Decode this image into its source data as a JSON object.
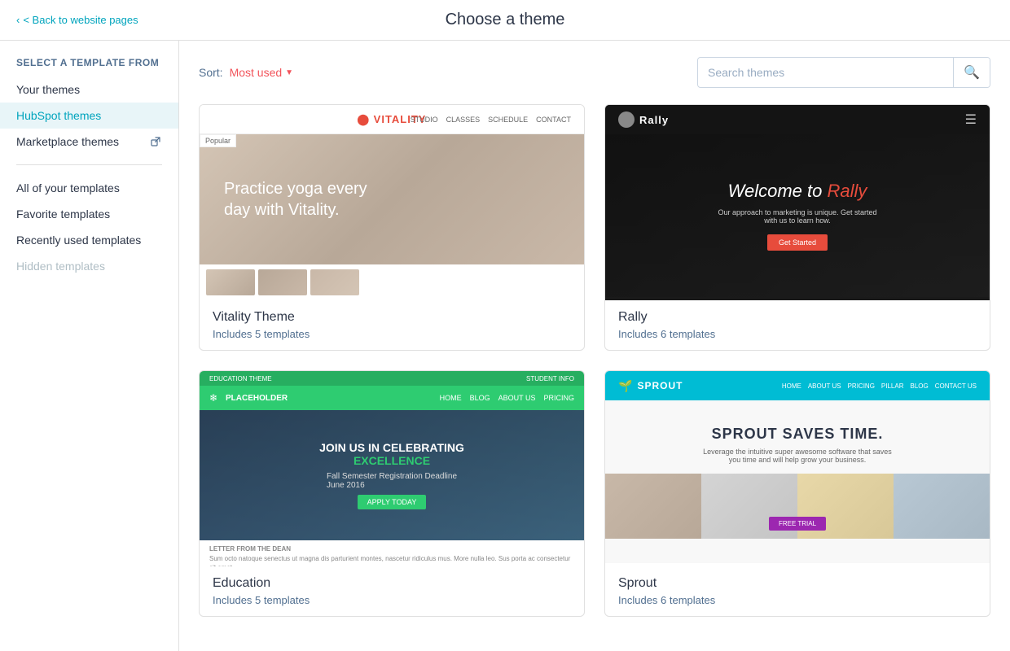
{
  "header": {
    "back_label": "< Back to website pages",
    "title": "Choose a theme"
  },
  "sidebar": {
    "section_label": "Select a template from",
    "items": [
      {
        "id": "your-themes",
        "label": "Your themes",
        "active": false
      },
      {
        "id": "hubspot-themes",
        "label": "HubSpot themes",
        "active": true
      },
      {
        "id": "marketplace-themes",
        "label": "Marketplace themes",
        "active": false,
        "external": true
      }
    ],
    "divider": true,
    "sub_items": [
      {
        "id": "all-templates",
        "label": "All of your templates",
        "active": false
      },
      {
        "id": "favorite-templates",
        "label": "Favorite templates",
        "active": false
      },
      {
        "id": "recently-used",
        "label": "Recently used templates",
        "active": false
      },
      {
        "id": "hidden-templates",
        "label": "Hidden templates",
        "active": false,
        "disabled": true
      }
    ]
  },
  "toolbar": {
    "sort_label": "Sort:",
    "sort_value": "Most used",
    "search_placeholder": "Search themes"
  },
  "themes": [
    {
      "id": "vitality",
      "name": "Vitality Theme",
      "templates": "Includes 5 templates",
      "type": "vitality"
    },
    {
      "id": "rally",
      "name": "Rally",
      "templates": "Includes 6 templates",
      "type": "rally"
    },
    {
      "id": "education",
      "name": "Education",
      "templates": "Includes 5 templates",
      "type": "education"
    },
    {
      "id": "sprout",
      "name": "Sprout",
      "templates": "Includes 6 templates",
      "type": "sprout"
    }
  ]
}
